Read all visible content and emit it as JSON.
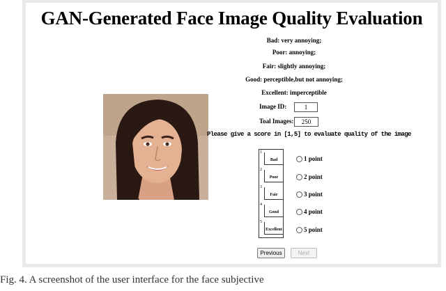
{
  "title": "GAN-Generated Face Image Quality Evaluation",
  "legend": [
    "Bad: very annoying;",
    "Poor: annoying;",
    "Fair: slightly annoying;",
    "Good: perceptible,but not annoying;",
    "Excellent: imperceptible"
  ],
  "image_id": {
    "label": "Image ID:",
    "value": "1"
  },
  "total_images": {
    "label": "Toal Images:",
    "value": "250"
  },
  "prompt": "Please give a score in [1,5] to evaluate quality of the image",
  "scale": [
    {
      "num": "1",
      "label": "Bad"
    },
    {
      "num": "2",
      "label": "Poor"
    },
    {
      "num": "3",
      "label": "Fair"
    },
    {
      "num": "4",
      "label": "Good"
    },
    {
      "num": "5",
      "label": "Excellent"
    }
  ],
  "options": [
    "1 point",
    "2 point",
    "3 point",
    "4 point",
    "5 point"
  ],
  "buttons": {
    "previous": "Previous",
    "next": "Next"
  },
  "caption": "Fig. 4.  A screenshot of the user interface for the face subjective"
}
